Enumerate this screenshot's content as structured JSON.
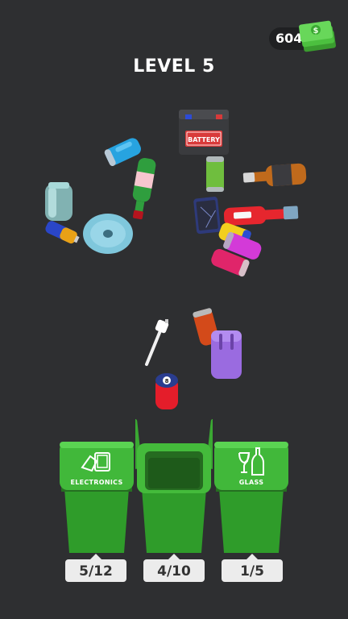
{
  "hud": {
    "currency": "604",
    "level_title": "LEVEL 5"
  },
  "items": {
    "battery_label": "BATTERY",
    "ball_number": "8"
  },
  "bins": [
    {
      "label": "ELECTRONICS",
      "counter": "5/12",
      "icon": "electronics-icon"
    },
    {
      "label": "",
      "counter": "4/10",
      "icon": ""
    },
    {
      "label": "GLASS",
      "counter": "1/5",
      "icon": "glass-bottle-icon"
    }
  ],
  "colors": {
    "background": "#2e2f31",
    "bin_green": "#3aa832",
    "bin_dark": "#2c8a27",
    "counter_bg": "#ececec"
  }
}
